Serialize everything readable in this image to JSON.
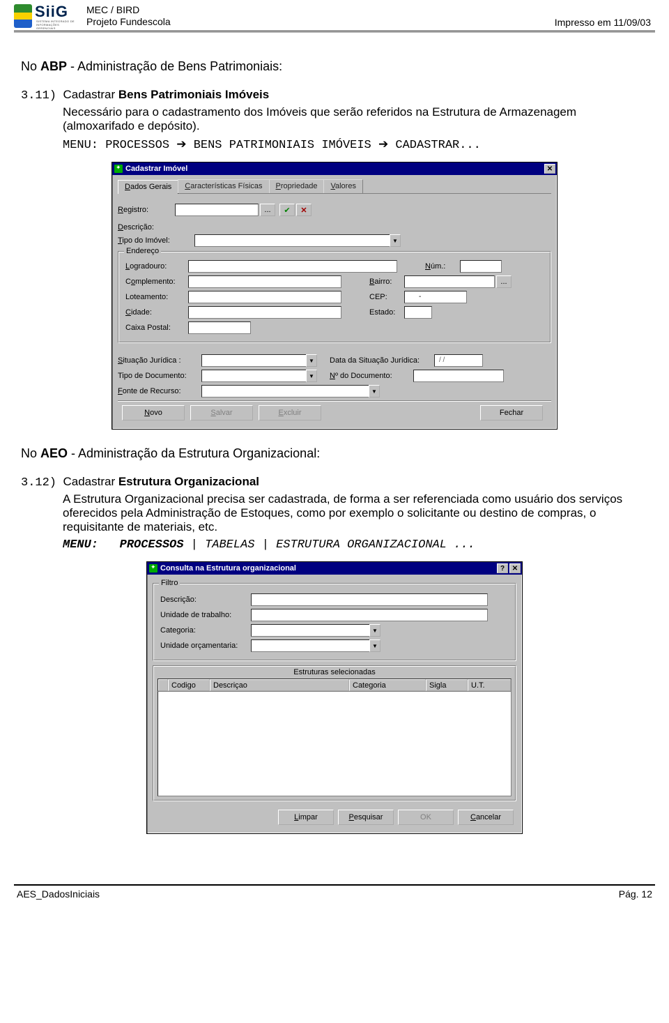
{
  "header": {
    "logo_brand": "SiiG",
    "logo_sub": "SISTEMA INTEGRADO DE INFORMAÇÕES GERENCIAIS",
    "line1": "MEC / BIRD",
    "line2": "Projeto Fundescola",
    "printed": "Impresso em 11/09/03"
  },
  "section1": {
    "prefix": "No ",
    "abbr": "ABP",
    "rest": " - Administração de Bens Patrimoniais:",
    "item_num": "3.11)",
    "item_cmd": "Cadastrar ",
    "item_obj": "Bens Patrimoniais Imóveis",
    "body": "Necessário para o cadastramento dos Imóveis que serão referidos na Estrutura de Armazenagem (almoxarifado e depósito).",
    "menu_label": "MENU:",
    "menu_parts": [
      "PROCESSOS",
      "BENS PATRIMONIAIS IMÓVEIS",
      "CADASTRAR..."
    ],
    "arrow": "➔"
  },
  "dialog1": {
    "title": "Cadastrar Imóvel",
    "tabs": [
      "Dados Gerais",
      "Características Físicas",
      "Propriedade",
      "Valores"
    ],
    "tabs_ul_idx": [
      0,
      0,
      0,
      0
    ],
    "registro_label": "Registro:",
    "registro_ul": "R",
    "btn_lookup": "...",
    "descricao_label": "Descrição:",
    "descricao_ul": "D",
    "tipo_imovel_label": "Tipo do Imóvel:",
    "tipo_imovel_ul": "T",
    "grp_endereco": "Endereço",
    "logradouro": "Logradouro:",
    "logradouro_ul": "L",
    "num": "Núm.:",
    "num_ul": "N",
    "complemento": "Complemento:",
    "complemento_ul": "o",
    "bairro": "Bairro:",
    "bairro_ul": "B",
    "loteamento": "Loteamento:",
    "cep": "CEP:",
    "cep_val": "-",
    "cidade": "Cidade:",
    "cidade_ul": "C",
    "estado": "Estado:",
    "caixa_postal": "Caixa Postal:",
    "situacao": "Situação Jurídica :",
    "situacao_ul": "S",
    "data_situacao": "Data da Situação Jurídica:",
    "data_situacao_val": "/ /",
    "tipo_doc": "Tipo de Documento:",
    "num_doc": "Nº do Documento:",
    "num_doc_ul": "N",
    "fonte": "Fonte de Recurso:",
    "fonte_ul": "F",
    "buttons": {
      "novo": "Novo",
      "salvar": "Salvar",
      "excluir": "Excluir",
      "fechar": "Fechar"
    },
    "buttons_ul": {
      "novo": "N",
      "salvar": "S",
      "excluir": "E",
      "fechar": ""
    }
  },
  "section2": {
    "prefix": "No ",
    "abbr": "AEO",
    "rest": " -  Administração da Estrutura Organizacional:",
    "item_num": "3.12)",
    "item_cmd": "Cadastrar ",
    "item_obj": "Estrutura Organizacional",
    "body": "A Estrutura Organizacional precisa ser cadastrada, de forma a ser referenciada como usuário dos serviços oferecidos pela Administração de Estoques, como por exemplo o solicitante ou destino de compras, o requisitante de materiais, etc.",
    "menu_label": "MENU:",
    "menu_parts": [
      "PROCESSOS",
      "TABELAS",
      "ESTRUTURA ORGANIZACIONAL ..."
    ],
    "sep": " | "
  },
  "dialog2": {
    "title": "Consulta na Estrutura organizacional",
    "grp_filtro": "Filtro",
    "descricao": "Descrição:",
    "unidade": "Unidade de trabalho:",
    "categoria": "Categoria:",
    "orcamentaria": "Unidade orçamentaria:",
    "grid_title": "Estruturas selecionadas",
    "cols": {
      "codigo": "Codigo",
      "descricao": "Descriçao",
      "categoria": "Categoria",
      "sigla": "Sigla",
      "ut": "U.T."
    },
    "buttons": {
      "limpar": "Limpar",
      "pesquisar": "Pesquisar",
      "ok": "OK",
      "cancelar": "Cancelar"
    },
    "buttons_ul": {
      "limpar": "L",
      "pesquisar": "P",
      "ok": "",
      "cancelar": "C"
    }
  },
  "footer": {
    "left": "AES_DadosIniciais",
    "right": "Pág.  12"
  }
}
